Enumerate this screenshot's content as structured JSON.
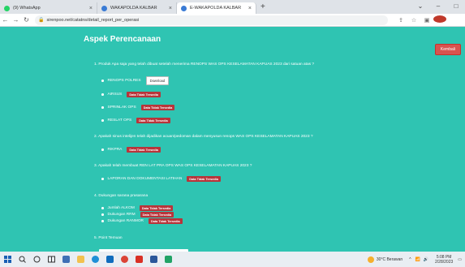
{
  "browser": {
    "tabs": [
      {
        "label": "(9) WhatsApp",
        "color": "#25d366"
      },
      {
        "label": "WAKAPOLDA KALBAR",
        "color": "#3a7bd5"
      },
      {
        "label": "E-WAKAPOLDA KALBAR",
        "color": "#3a7bd5"
      }
    ],
    "new_tab": "+",
    "address": "sirenpoo.net/catatns/detail_report_per_operasi"
  },
  "page": {
    "heading": "Aspek Perencanaan",
    "kembali": "Kembali",
    "questions": [
      "1. Produk Apa saja yang telah dibuat setelah menerima RENOPS WAS OPS KESELAMATAN KAPUAS 2023 dari satuan atas ?",
      "2. Apakah sinus intelijen telah dijadikan acuan/pedoman dalam menyusun renops WAS OPS KESELAMATAN KAPUAS 2023 ?",
      "3. Apakah telah membuat REN LAT PRA OPS WAS OPS KESELAMATAN KAPUAS 2023 ?",
      "4. Dukungan sarana prasarana",
      "5. Point Temuan"
    ],
    "items": [
      {
        "label": "RENOPS POLRES",
        "action": "Download"
      },
      {
        "label": "AIRSUS",
        "badge": "Data Tidak Tersedia"
      },
      {
        "label": "SPRINLAK OPS",
        "badge": "Data Tidak Tersedia"
      },
      {
        "label": "RESLAT OPS",
        "badge": "Data Tidak Tersedia"
      },
      {
        "label": "RIKPRA",
        "badge": "Data Tidak Tersedia"
      },
      {
        "label": "LAPORAN DAN DOKUMENTASI LATIHAN",
        "badge": "Data Tidak Tersedia"
      },
      {
        "label": "Jumlah ALKOM",
        "badge": "Data Tidak Tersedia"
      },
      {
        "label": "Dukungan RRM",
        "badge": "Data Tidak Tersedia"
      },
      {
        "label": "Dukungan RANMOR",
        "badge": "Data Tidak Tersedia"
      }
    ]
  },
  "taskbar": {
    "weather": "30°C Berawan",
    "time": "5:08 PM",
    "date": "2/28/2023"
  }
}
